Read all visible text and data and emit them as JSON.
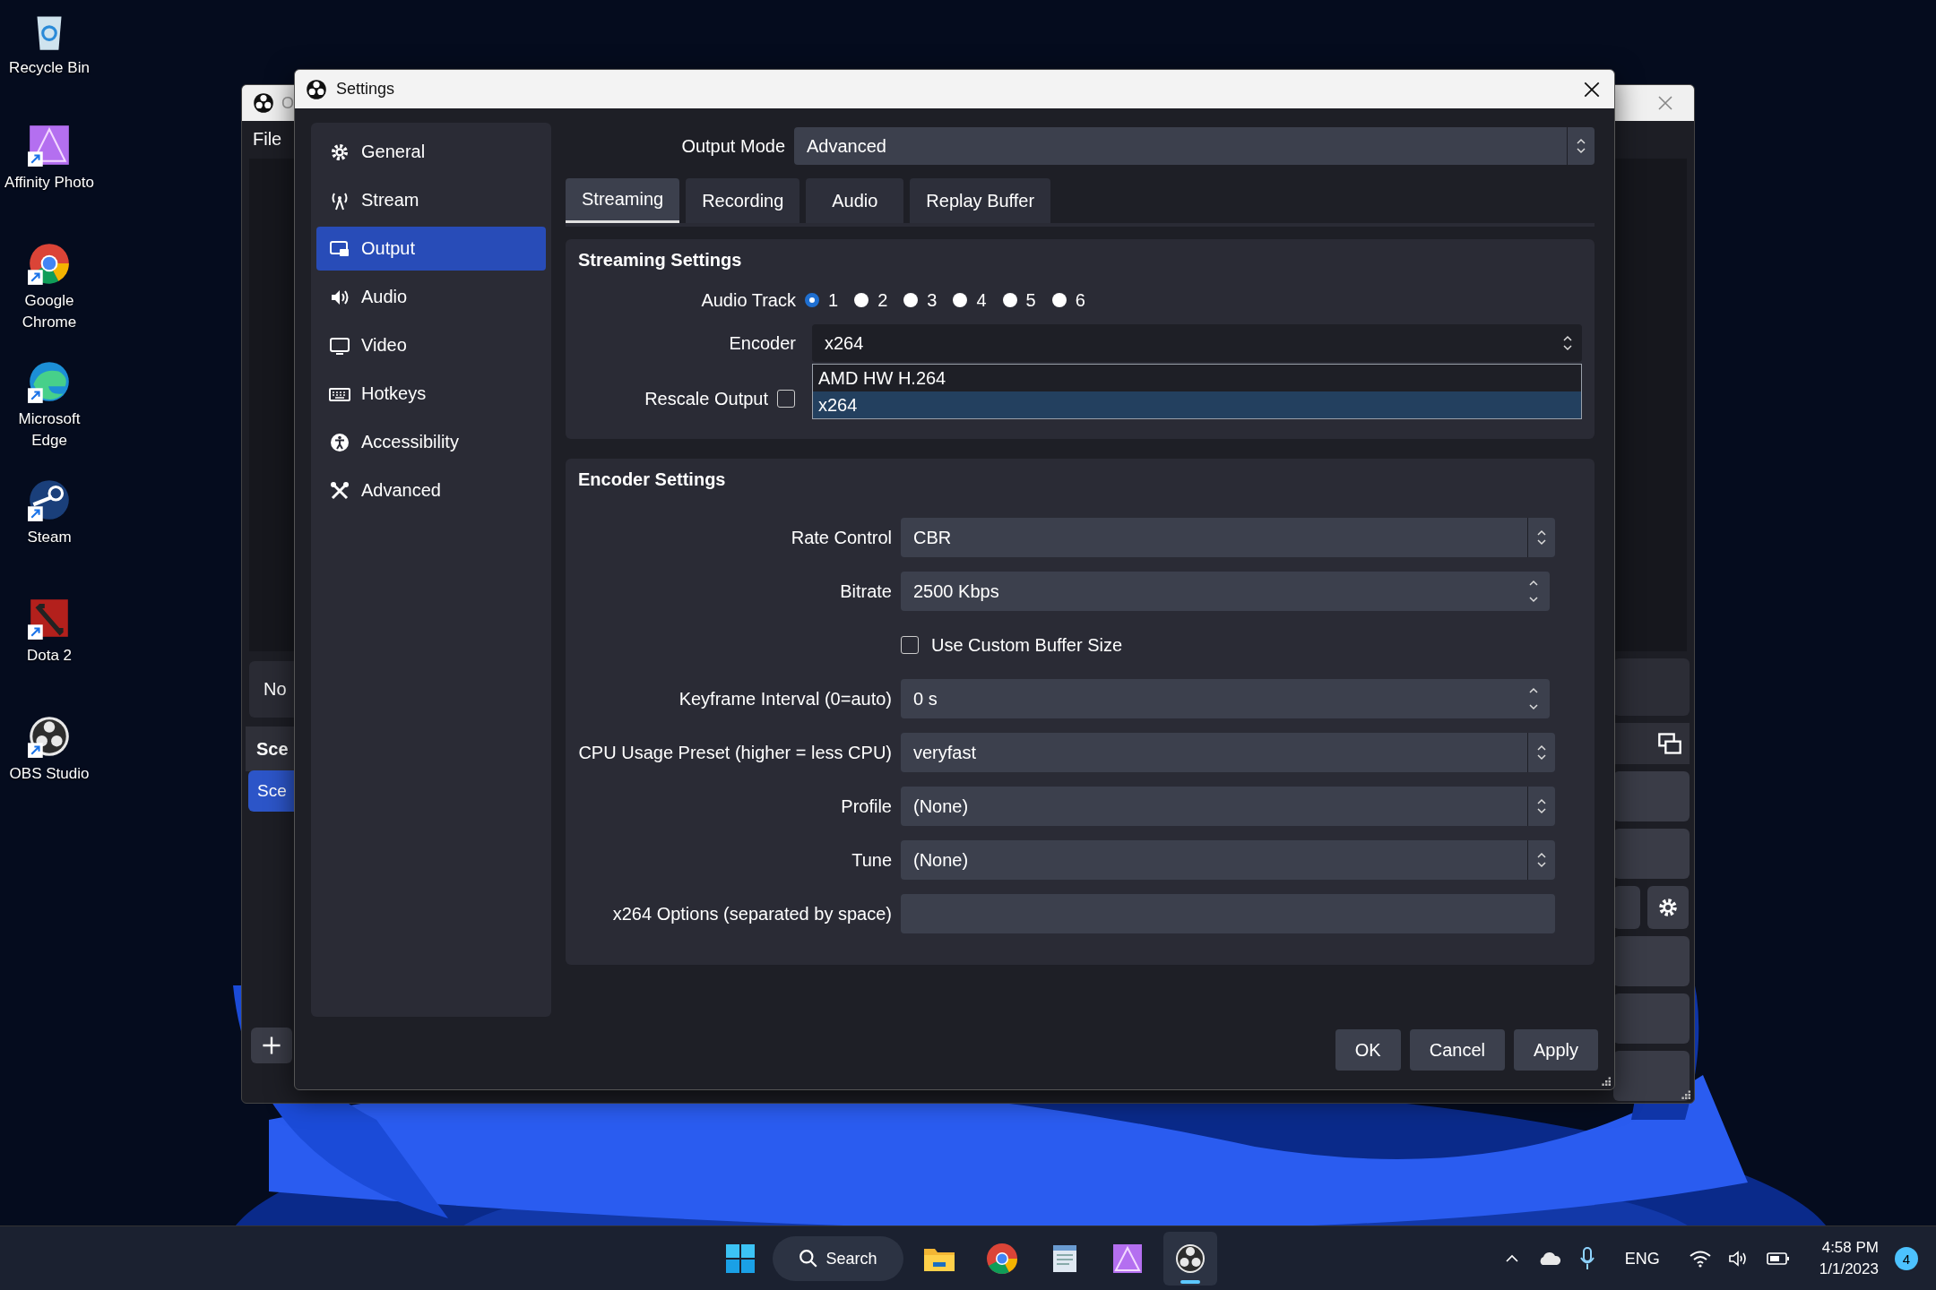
{
  "desktop_icons": [
    {
      "label": "Recycle Bin"
    },
    {
      "label": "Affinity Photo"
    },
    {
      "label": "Google Chrome"
    },
    {
      "label": "Microsoft Edge"
    },
    {
      "label": "Steam"
    },
    {
      "label": "Dota 2"
    },
    {
      "label": "OBS Studio"
    }
  ],
  "background_window": {
    "title": "O",
    "menu": [
      "File"
    ],
    "preview_text": "No",
    "scenes_header": "Sce",
    "scenes": [
      {
        "label": "Sce",
        "selected": true
      }
    ]
  },
  "settings": {
    "title": "Settings",
    "sidebar": [
      {
        "label": "General",
        "selected": false
      },
      {
        "label": "Stream",
        "selected": false
      },
      {
        "label": "Output",
        "selected": true
      },
      {
        "label": "Audio",
        "selected": false
      },
      {
        "label": "Video",
        "selected": false
      },
      {
        "label": "Hotkeys",
        "selected": false
      },
      {
        "label": "Accessibility",
        "selected": false
      },
      {
        "label": "Advanced",
        "selected": false
      }
    ],
    "output_mode": {
      "label": "Output Mode",
      "value": "Advanced"
    },
    "tabs": [
      {
        "label": "Streaming",
        "selected": true
      },
      {
        "label": "Recording",
        "selected": false
      },
      {
        "label": "Audio",
        "selected": false
      },
      {
        "label": "Replay Buffer",
        "selected": false
      }
    ],
    "streaming": {
      "title": "Streaming Settings",
      "audio_track": {
        "label": "Audio Track",
        "options": [
          {
            "label": "1",
            "selected": true
          },
          {
            "label": "2",
            "selected": false
          },
          {
            "label": "3",
            "selected": false
          },
          {
            "label": "4",
            "selected": false
          },
          {
            "label": "5",
            "selected": false
          },
          {
            "label": "6",
            "selected": false
          }
        ]
      },
      "encoder": {
        "label": "Encoder",
        "value": "x264",
        "expanded": true,
        "options": [
          {
            "label": "AMD HW H.264",
            "selected": false
          },
          {
            "label": "x264",
            "selected": true
          }
        ]
      },
      "rescale": {
        "label": "Rescale Output",
        "checked": false
      }
    },
    "encoder_settings": {
      "title": "Encoder Settings",
      "rows": [
        {
          "kind": "select",
          "label": "Rate Control",
          "value": "CBR"
        },
        {
          "kind": "spin",
          "label": "Bitrate",
          "value": "2500 Kbps"
        },
        {
          "kind": "checkbox",
          "label": "Use Custom Buffer Size",
          "checked": false
        },
        {
          "kind": "spin",
          "label": "Keyframe Interval (0=auto)",
          "value": "0 s"
        },
        {
          "kind": "select",
          "label": "CPU Usage Preset (higher = less CPU)",
          "value": "veryfast"
        },
        {
          "kind": "select",
          "label": "Profile",
          "value": "(None)"
        },
        {
          "kind": "select",
          "label": "Tune",
          "value": "(None)"
        },
        {
          "kind": "text",
          "label": "x264 Options (separated by space)",
          "value": ""
        }
      ]
    },
    "buttons": [
      "OK",
      "Cancel",
      "Apply"
    ]
  },
  "taskbar": {
    "search": "Search",
    "apps": [
      {
        "selected": false
      },
      {
        "selected": false
      },
      {
        "selected": false
      },
      {
        "selected": false
      },
      {
        "selected": true
      }
    ],
    "language": "ENG",
    "time": "4:58 PM",
    "date": "1/1/2023",
    "notifications": "4"
  }
}
